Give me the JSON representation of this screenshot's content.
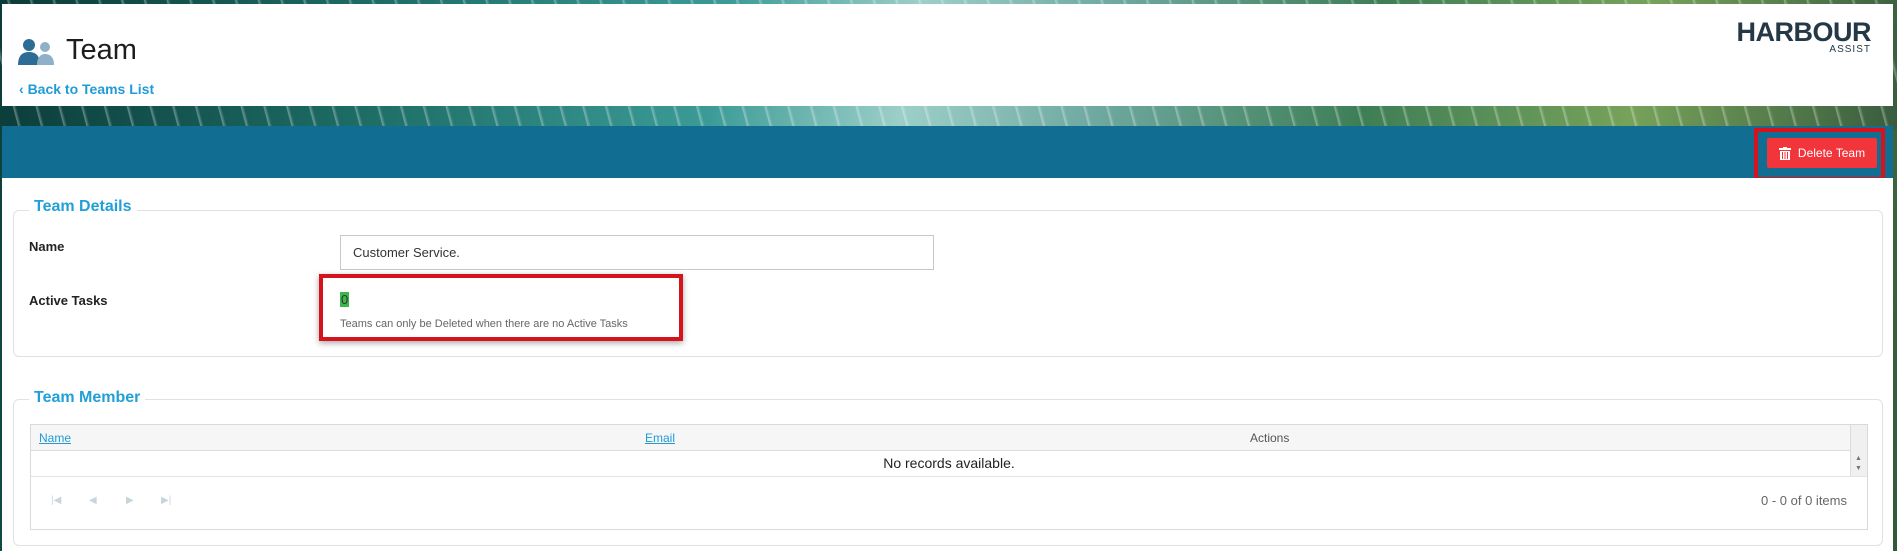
{
  "header": {
    "title": "Team",
    "back_link": "Back to Teams List",
    "logo_main": "HARBOUR",
    "logo_sub": "ASSIST"
  },
  "toolbar": {
    "delete_label": "Delete Team",
    "accent": "#126d92",
    "delete_color": "#f2353b"
  },
  "team_details": {
    "legend": "Team Details",
    "name_label": "Name",
    "name_value": "Customer Service.",
    "active_tasks_label": "Active Tasks",
    "active_tasks_value": "0",
    "hint": "Teams can only be Deleted when there are no Active Tasks"
  },
  "team_member": {
    "legend": "Team Member",
    "columns": [
      "Name",
      "Email",
      "Actions"
    ],
    "empty_text": "No records available.",
    "pager": {
      "info": "0 - 0 of 0 items",
      "icons": [
        "first-page-icon",
        "prev-page-icon",
        "next-page-icon",
        "last-page-icon"
      ]
    }
  }
}
